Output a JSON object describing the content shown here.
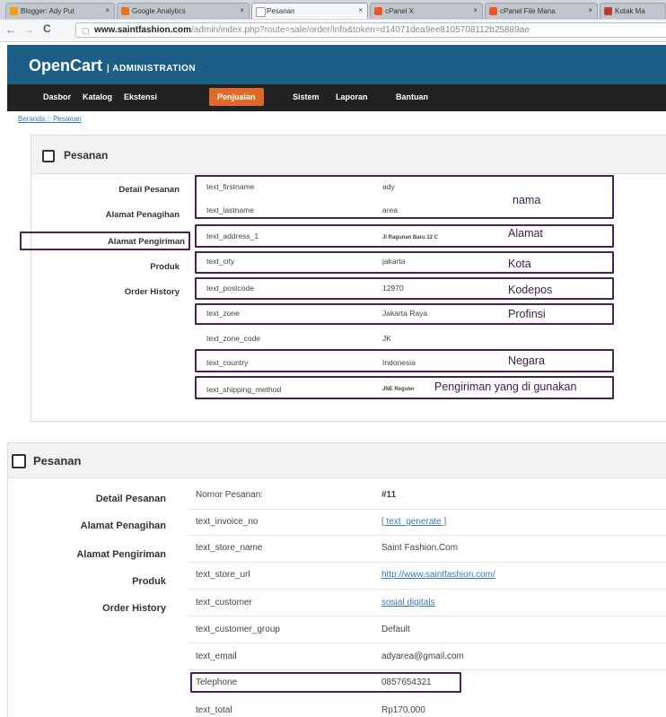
{
  "browser": {
    "tabs": [
      {
        "title": "Blogger: Ady Put",
        "color": "#f39c12"
      },
      {
        "title": "Google Analytics",
        "color": "#e8711c"
      },
      {
        "title": "Pesanan",
        "color": "#ffffff"
      },
      {
        "title": "cPanel X",
        "color": "#f0542b"
      },
      {
        "title": "cPanel File Mana",
        "color": "#f0542b"
      },
      {
        "title": "Kotak Ma",
        "color": "#c0392b"
      }
    ],
    "url_domain": "www.saintfashion.com",
    "url_rest": "/admin/index.php?route=sale/order/info&token=d14071dea9ee8105708112b25889ae",
    "back_icon": "back-arrow-icon",
    "forward_icon": "forward-arrow-icon",
    "reload_icon": "reload-icon"
  },
  "header": {
    "logo": "OpenCart",
    "subtitle": "| ADMINISTRATION",
    "brand_color": "#1b5e86",
    "menu": [
      "Dasbor",
      "Katalog",
      "Ekstensi",
      "Penjualan",
      "Sistem",
      "Laporan",
      "Bantuan"
    ],
    "active_menu": "Penjualan",
    "accent_color": "#e06a2a"
  },
  "breadcrumb": [
    "Beranda",
    "Pesanan"
  ],
  "panel1": {
    "title": "Pesanan",
    "vtabs": [
      "Detail Pesanan",
      "Alamat Penagihan",
      "Alamat Pengiriman",
      "Produk",
      "Order History"
    ],
    "active_vtab": "Alamat Pengiriman",
    "rows": [
      {
        "key": "text_firstname",
        "value": "ady"
      },
      {
        "key": "text_lastname",
        "value": "area"
      },
      {
        "key": "text_address_1",
        "value": "Jl Ragunan Baru 12 C"
      },
      {
        "key": "text_city",
        "value": "jakarta"
      },
      {
        "key": "text_postcode",
        "value": "12970"
      },
      {
        "key": "text_zone",
        "value": "Jakarta Raya"
      },
      {
        "key": "text_zone_code",
        "value": "JK"
      },
      {
        "key": "text_country",
        "value": "Indonesia"
      },
      {
        "key": "text_shipping_method",
        "value": "JNE Reguler"
      }
    ],
    "notes": {
      "nama": "nama",
      "alamat": "Alamat",
      "kota": "Kota",
      "kodepos": "Kodepos",
      "profinsi": "Profinsi",
      "negara": "Negara",
      "pengiriman": "Pengiriman yang di gunakan"
    },
    "highlight_color": "#4d1f5b"
  },
  "panel2": {
    "title": "Pesanan",
    "vtabs": [
      "Detail Pesanan",
      "Alamat Penagihan",
      "Alamat Pengiriman",
      "Produk",
      "Order History"
    ],
    "rows": [
      {
        "key": "Nomor Pesanan:",
        "value": "#11"
      },
      {
        "key": "text_invoice_no",
        "value": "[ text_generate ]"
      },
      {
        "key": "text_store_name",
        "value": "Saint Fashion.Com"
      },
      {
        "key": "text_store_url",
        "value": "http://www.saintfashion.com/"
      },
      {
        "key": "text_customer",
        "value": "sosial digitals"
      },
      {
        "key": "text_customer_group",
        "value": "Default"
      },
      {
        "key": "text_email",
        "value": "adyarea@gmail.com"
      },
      {
        "key": "Telephone",
        "value": "0857654321"
      },
      {
        "key": "text_total",
        "value": "Rp170.000"
      }
    ]
  }
}
